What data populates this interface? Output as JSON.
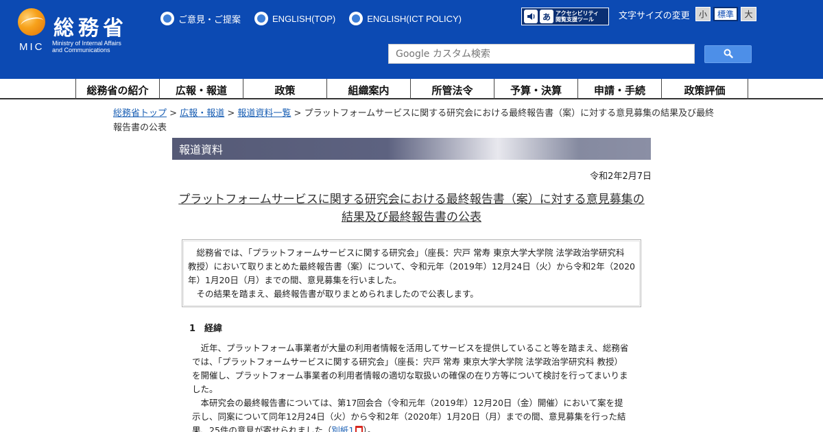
{
  "header": {
    "logo_kanji": "総務省",
    "logo_abbr": "MIC",
    "logo_en_line1": "Ministry of Internal Affairs",
    "logo_en_line2": "and Communications",
    "links": [
      "ご意見・ご提案",
      "ENGLISH(TOP)",
      "ENGLISH(ICT POLICY)"
    ],
    "accessibility_line1": "アクセシビリティ",
    "accessibility_line2": "閲覧支援ツール",
    "accessibility_glyph": "あ",
    "fontsize_label": "文字サイズの変更",
    "fontsize_small": "小",
    "fontsize_normal": "標準",
    "fontsize_large": "大",
    "search_placeholder": "Google カスタム検索"
  },
  "nav": [
    "総務省の紹介",
    "広報・報道",
    "政策",
    "組織案内",
    "所管法令",
    "予算・決算",
    "申請・手続",
    "政策評価"
  ],
  "breadcrumb": {
    "items": [
      "総務省トップ",
      "広報・報道",
      "報道資料一覧"
    ],
    "separator": " > ",
    "current": "プラットフォームサービスに関する研究会における最終報告書（案）に対する意見募集の結果及び最終報告書の公表"
  },
  "section_title": "報道資料",
  "date": "令和2年2月7日",
  "title_line1": "プラットフォームサービスに関する研究会における最終報告書（案）に対する意見募集の",
  "title_line2": "結果及び最終報告書の公表",
  "summary": {
    "p1": "　総務省では、「プラットフォームサービスに関する研究会」（座長：宍戸 常寿 東京大学大学院 法学政治学研究科 教授）において取りまとめた最終報告書（案）について、令和元年（2019年）12月24日（火）から令和2年（2020年）1月20日（月）までの間、意見募集を行いました。",
    "p2": "　その結果を踏まえ、最終報告書が取りまとめられましたので公表します。"
  },
  "section1_heading": "1　経緯",
  "section1": {
    "p1": "近年、プラットフォーム事業者が大量の利用者情報を活用してサービスを提供していること等を踏まえ、総務省では、「プラットフォームサービスに関する研究会」（座長：宍戸 常寿 東京大学大学院 法学政治学研究科 教授）を開催し、プラットフォーム事業者の利用者情報の適切な取扱いの確保の在り方等について検討を行ってまいりました。",
    "p2_before": "本研究会の最終報告書については、第17回会合（令和元年（2019年）12月20日（金）開催）において案を提示し、同案について同年12月24日（火）から令和2年（2020年）1月20日（月）までの間、意見募集を行った結果、25件の意見が寄せられました（",
    "p2_link": "別紙1",
    "p2_after": "）。"
  }
}
